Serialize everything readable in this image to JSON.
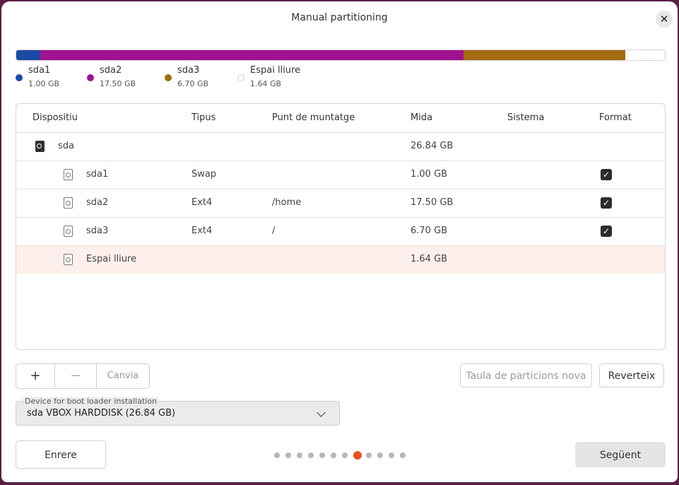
{
  "window": {
    "title": "Manual partitioning",
    "close_icon": "close-icon"
  },
  "colors": {
    "sda1": "#1a4aa8",
    "sda2": "#a0128f",
    "sda3": "#a36a10",
    "free": "#ffffff",
    "accent": "#e95420"
  },
  "usage": {
    "segments": [
      {
        "name": "sda1",
        "size": "1.00 GB",
        "fraction": 0.0373,
        "color": "#1a4aa8"
      },
      {
        "name": "sda2",
        "size": "17.50 GB",
        "fraction": 0.652,
        "color": "#a0128f"
      },
      {
        "name": "sda3",
        "size": "6.70 GB",
        "fraction": 0.2496,
        "color": "#a36a10"
      },
      {
        "name": "Espai lliure",
        "size": "1.64 GB",
        "fraction": 0.0611,
        "color": "#ffffff"
      }
    ]
  },
  "table": {
    "headers": [
      "Dispositiu",
      "Tipus",
      "Punt de muntatge",
      "Mida",
      "Sistema",
      "Format"
    ],
    "rows": [
      {
        "device": "sda",
        "type": "",
        "mount": "",
        "size": "26.84 GB",
        "system": "",
        "format": false
      },
      {
        "device": "sda1",
        "type": "Swap",
        "mount": "",
        "size": "1.00 GB",
        "system": "",
        "format": true
      },
      {
        "device": "sda2",
        "type": "Ext4",
        "mount": "/home",
        "size": "17.50 GB",
        "system": "",
        "format": true
      },
      {
        "device": "sda3",
        "type": "Ext4",
        "mount": "/",
        "size": "6.70 GB",
        "system": "",
        "format": true
      },
      {
        "device": "Espai lliure",
        "type": "",
        "mount": "",
        "size": "1.64 GB",
        "system": "",
        "format": false
      }
    ]
  },
  "actions": {
    "add": "+",
    "remove": "−",
    "change": "Canvia",
    "new_table": "Taula de particions nova",
    "revert": "Reverteix"
  },
  "boot": {
    "label": "Device for boot loader installation",
    "value": "sda VBOX HARDDISK (26.84 GB)"
  },
  "nav": {
    "back": "Enrere",
    "next": "Següent",
    "steps_total": 12,
    "current_step": 8
  }
}
